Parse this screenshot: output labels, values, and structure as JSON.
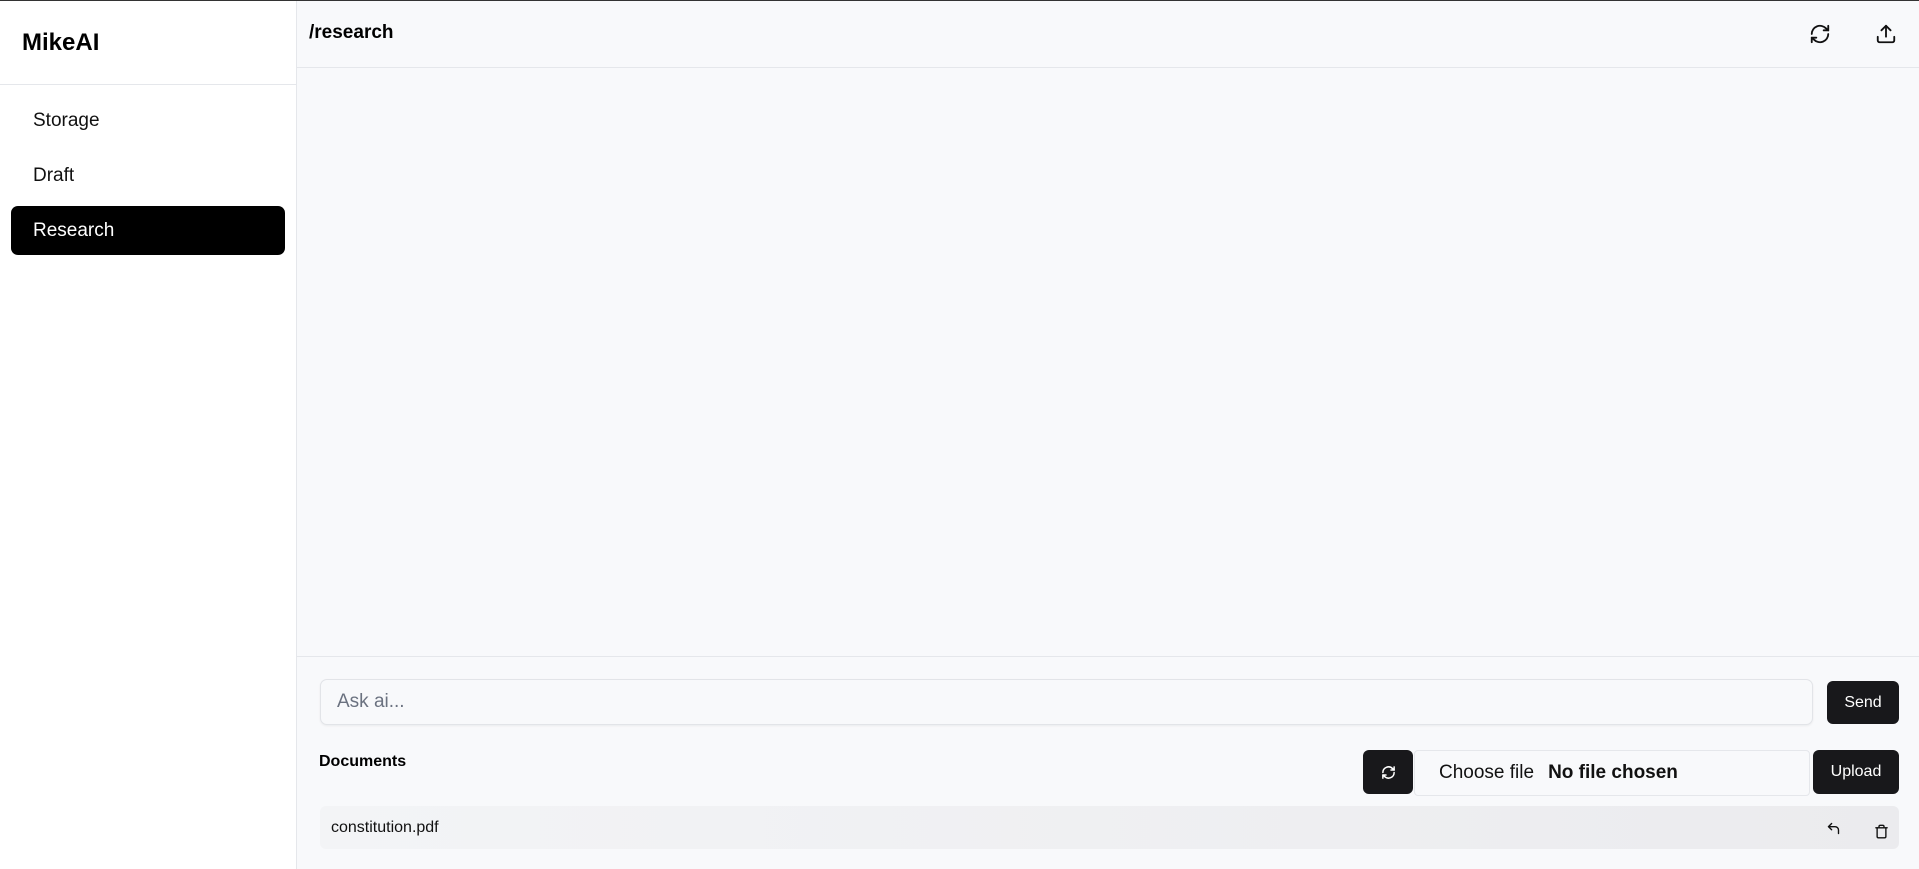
{
  "app": {
    "brand": "MikeAI"
  },
  "sidebar": {
    "items": [
      {
        "label": "Storage",
        "active": false
      },
      {
        "label": "Draft",
        "active": false
      },
      {
        "label": "Research",
        "active": true
      }
    ]
  },
  "header": {
    "path": "/research",
    "icons": [
      "refresh-icon",
      "upload-icon"
    ]
  },
  "chat": {
    "placeholder": "Ask ai...",
    "value": "",
    "send_label": "Send"
  },
  "documents": {
    "heading": "Documents",
    "refresh_icon": "refresh-icon",
    "file_picker": {
      "button_label": "Choose file",
      "status": "No file chosen"
    },
    "upload_label": "Upload",
    "items": [
      {
        "name": "constitution.pdf",
        "icons": [
          "undo-icon",
          "trash-icon"
        ]
      }
    ]
  },
  "colors": {
    "active_nav_bg": "#000000",
    "button_bg": "#18181b",
    "main_bg": "#f8f9fb",
    "border": "#e5e7eb"
  }
}
